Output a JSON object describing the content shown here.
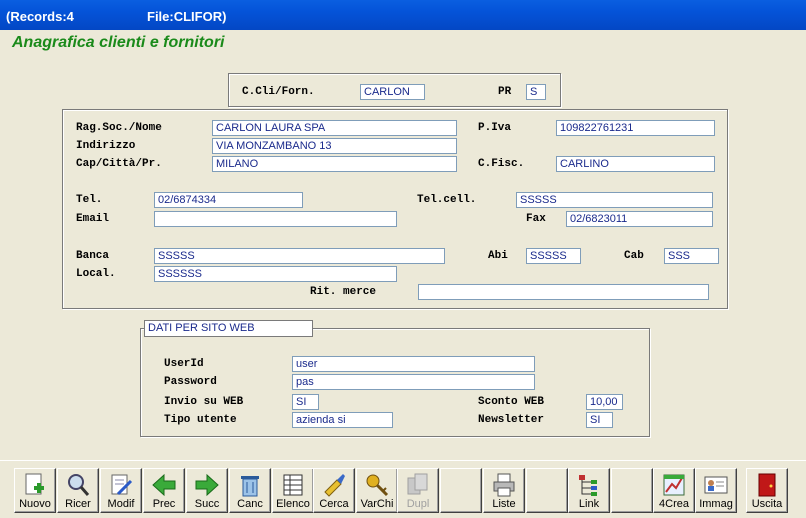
{
  "window": {
    "records": "(Records:4",
    "file": "File:CLIFOR)"
  },
  "heading": "Anagrafica clienti e fornitori",
  "top": {
    "code_label": "C.Cli/Forn.",
    "code_value": "CARLON",
    "pr_label": "PR",
    "pr_value": "S"
  },
  "main": {
    "ragsoc_label": "Rag.Soc./Nome",
    "ragsoc_value": "CARLON LAURA SPA",
    "indirizzo_label": "Indirizzo",
    "indirizzo_value": "VIA MONZAMBANO 13",
    "cap_label": "Cap/Città/Pr.",
    "cap_value": "MILANO",
    "piva_label": "P.Iva",
    "piva_value": "109822761231",
    "cfisc_label": "C.Fisc.",
    "cfisc_value": "CARLINO",
    "tel_label": "Tel.",
    "tel_value": "02/6874334",
    "telcell_label": "Tel.cell.",
    "telcell_value": "SSSSS",
    "email_label": "Email",
    "email_value": "",
    "fax_label": "Fax",
    "fax_value": "02/6823011",
    "banca_label": "Banca",
    "banca_value": "SSSSS",
    "abi_label": "Abi",
    "abi_value": "SSSSS",
    "cab_label": "Cab",
    "cab_value": "SSS",
    "local_label": "Local.",
    "local_value": "SSSSSS",
    "rit_label": "Rit. merce",
    "rit_value": ""
  },
  "web": {
    "title": "DATI PER SITO WEB",
    "userid_label": "UserId",
    "userid_value": "user",
    "password_label": "Password",
    "password_value": "pas",
    "invio_label": "Invio su WEB",
    "invio_value": "SI",
    "tipo_label": "Tipo utente",
    "tipo_value": "azienda si",
    "sconto_label": "Sconto WEB",
    "sconto_value": "10,00",
    "newsletter_label": "Newsletter",
    "newsletter_value": "SI"
  },
  "toolbar": {
    "nuovo": "Nuovo",
    "ricer": "Ricer",
    "modif": "Modif",
    "prec": "Prec",
    "succ": "Succ",
    "canc": "Canc",
    "elenco": "Elenco",
    "cerca": "Cerca",
    "varchi": "VarChi",
    "dupl": "Dupl",
    "liste": "Liste",
    "link": "Link",
    "crea": "4Crea",
    "immag": "Immag",
    "uscita": "Uscita"
  },
  "colors": {
    "title_blue": "#0453d8",
    "heading_green": "#1a8a1a",
    "field_text": "#1a2a8c"
  }
}
